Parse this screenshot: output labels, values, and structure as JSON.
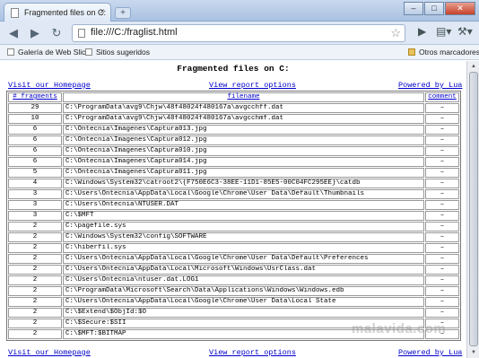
{
  "browser": {
    "tab_title": "Fragmented files on C:",
    "tab_close": "×",
    "new_tab": "+",
    "window_buttons": {
      "minimize": "–",
      "maximize": "□",
      "close": "✕"
    },
    "address": "file:///C:/fraglist.html",
    "icons": {
      "back": "back-arrow-icon",
      "forward": "forward-arrow-icon",
      "reload": "reload-icon",
      "star": "bookmark-star-icon",
      "page": "page-menu-icon",
      "wrench": "wrench-icon"
    },
    "bookmarks": [
      {
        "label": "Galería de Web Slice"
      },
      {
        "label": "Sitios sugeridos"
      }
    ],
    "other_bookmarks": "Otros marcadores"
  },
  "page": {
    "title": "Fragmented files on C:",
    "links": {
      "homepage": "Visit our Homepage",
      "report_options": "View report options",
      "powered_by": "Powered by Lua"
    },
    "table": {
      "headers": {
        "fragments": "# fragments",
        "filename": "filename",
        "comment": "comment"
      },
      "rows": [
        {
          "fragments": "29",
          "filename": "C:\\ProgramData\\avg9\\Chjw\\48f48024f480167a\\avgcchff.dat",
          "comment": "–"
        },
        {
          "fragments": "10",
          "filename": "C:\\ProgramData\\avg9\\Chjw\\48f48024f480167a\\avgcchmf.dat",
          "comment": "–"
        },
        {
          "fragments": "6",
          "filename": "C:\\Ontecnia\\Imagenes\\Captura013.jpg",
          "comment": "–"
        },
        {
          "fragments": "6",
          "filename": "C:\\Ontecnia\\Imagenes\\Captura012.jpg",
          "comment": "–"
        },
        {
          "fragments": "6",
          "filename": "C:\\Ontecnia\\Imagenes\\Captura010.jpg",
          "comment": "–"
        },
        {
          "fragments": "6",
          "filename": "C:\\Ontecnia\\Imagenes\\Captura014.jpg",
          "comment": "–"
        },
        {
          "fragments": "5",
          "filename": "C:\\Ontecnia\\Imagenes\\Captura011.jpg",
          "comment": "–"
        },
        {
          "fragments": "4",
          "filename": "C:\\Windows\\System32\\catroot2\\{F750E6C3-38EE-11D1-85E5-00C04FC295EE}\\catdb",
          "comment": "–"
        },
        {
          "fragments": "3",
          "filename": "C:\\Users\\Ontecnia\\AppData\\Local\\Google\\Chrome\\User Data\\Default\\Thumbnails",
          "comment": "–"
        },
        {
          "fragments": "3",
          "filename": "C:\\Users\\Ontecnia\\NTUSER.DAT",
          "comment": "–"
        },
        {
          "fragments": "3",
          "filename": "C:\\$MFT",
          "comment": "–"
        },
        {
          "fragments": "2",
          "filename": "C:\\pagefile.sys",
          "comment": "–"
        },
        {
          "fragments": "2",
          "filename": "C:\\Windows\\System32\\config\\SOFTWARE",
          "comment": "–"
        },
        {
          "fragments": "2",
          "filename": "C:\\hiberfil.sys",
          "comment": "–"
        },
        {
          "fragments": "2",
          "filename": "C:\\Users\\Ontecnia\\AppData\\Local\\Google\\Chrome\\User Data\\Default\\Preferences",
          "comment": "–"
        },
        {
          "fragments": "2",
          "filename": "C:\\Users\\Ontecnia\\AppData\\Local\\Microsoft\\Windows\\UsrClass.dat",
          "comment": "–"
        },
        {
          "fragments": "2",
          "filename": "C:\\Users\\Ontecnia\\ntuser.dat.LOG1",
          "comment": "–"
        },
        {
          "fragments": "2",
          "filename": "C:\\ProgramData\\Microsoft\\Search\\Data\\Applications\\Windows\\Windows.edb",
          "comment": "–"
        },
        {
          "fragments": "2",
          "filename": "C:\\Users\\Ontecnia\\AppData\\Local\\Google\\Chrome\\User Data\\Local State",
          "comment": "–"
        },
        {
          "fragments": "2",
          "filename": "C:\\$Extend\\$ObjId:$O",
          "comment": "–"
        },
        {
          "fragments": "2",
          "filename": "C:\\$Secure:$SII",
          "comment": "–"
        },
        {
          "fragments": "2",
          "filename": "C:\\$MFT:$BITMAP",
          "comment": "–"
        }
      ]
    }
  },
  "watermark": "malavida.com"
}
